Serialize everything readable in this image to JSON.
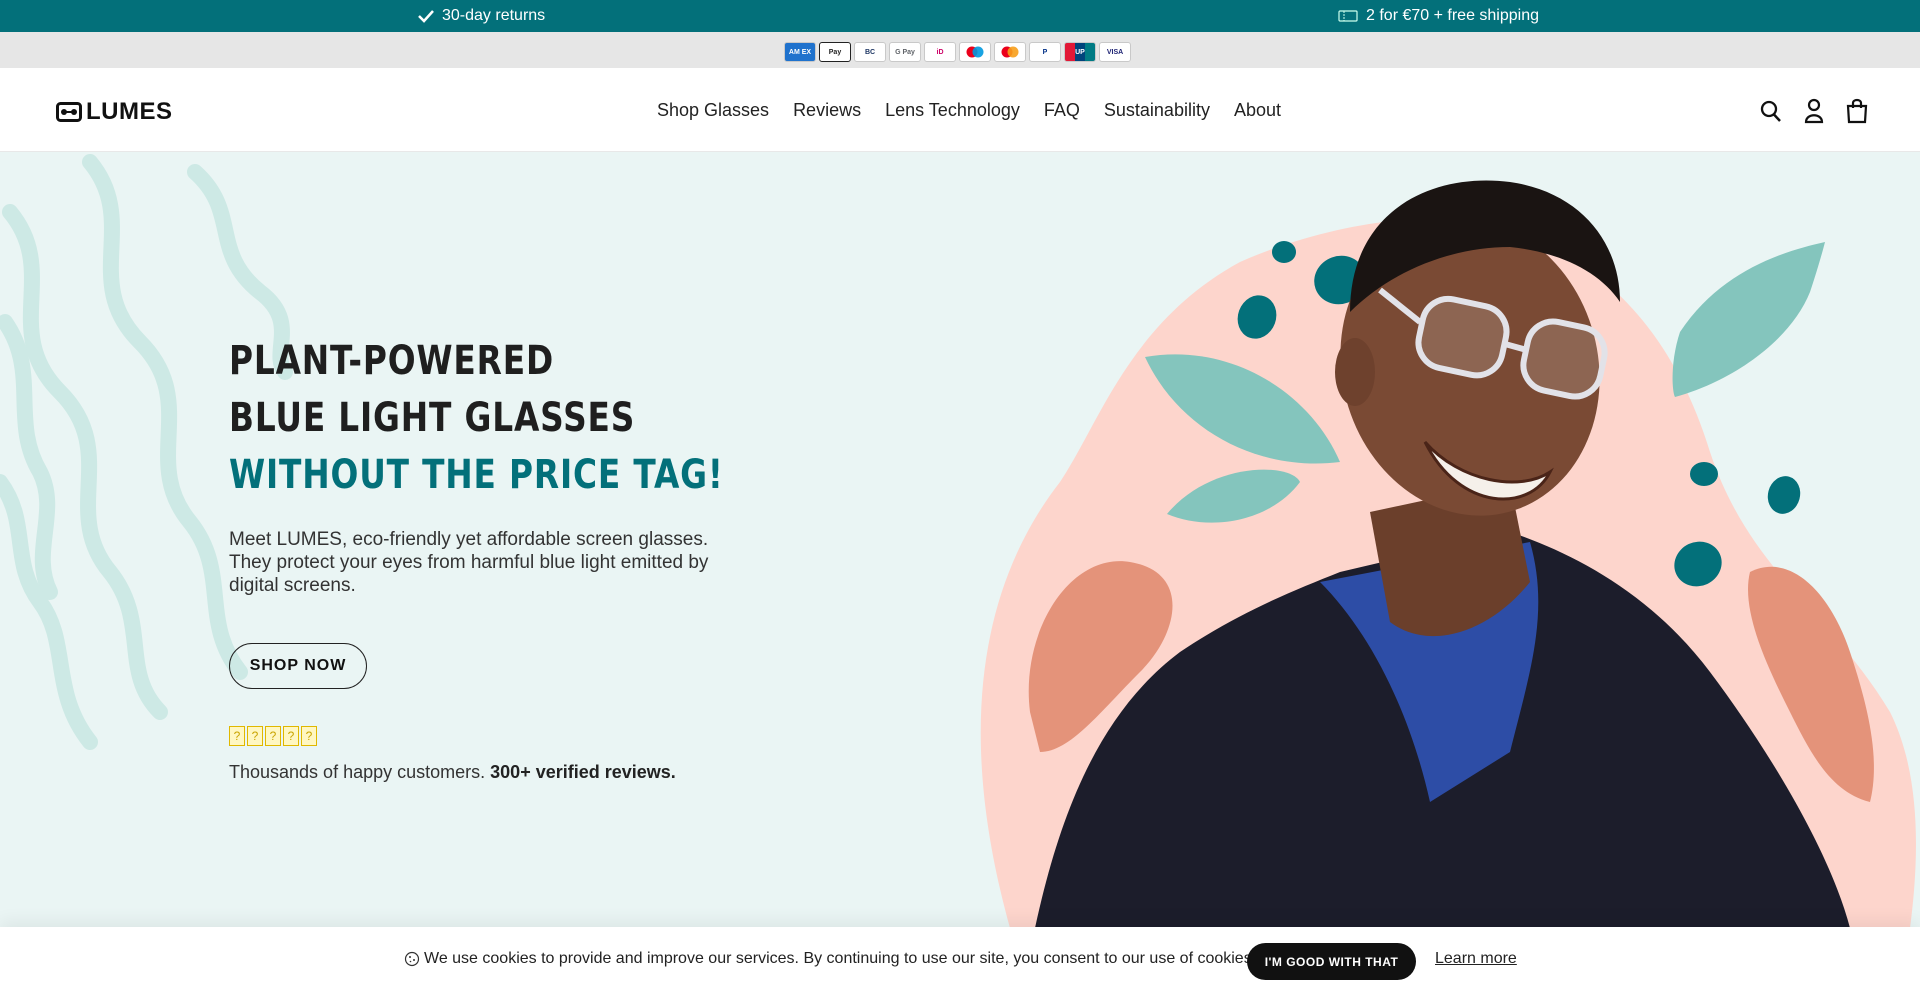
{
  "announcement": {
    "returns_text": "30-day returns",
    "returns_icon": "check-icon",
    "shipping_text": "2 for €70 + free shipping",
    "shipping_icon": "ticket-icon"
  },
  "payment_methods": [
    "American Express",
    "Apple Pay",
    "Bancontact",
    "Google Pay",
    "iDEAL",
    "Maestro",
    "Mastercard",
    "PayPal",
    "UnionPay",
    "Visa"
  ],
  "payment_labels": [
    "AM EX",
    "Pay",
    "BC",
    "G Pay",
    "iD",
    "Mae",
    "MC",
    "P",
    "UP",
    "VISA"
  ],
  "header": {
    "logo": "LUMES",
    "nav": [
      "Shop Glasses",
      "Reviews",
      "Lens Technology",
      "FAQ",
      "Sustainability",
      "About"
    ],
    "icons": [
      "search-icon",
      "account-icon",
      "cart-icon"
    ]
  },
  "hero": {
    "heading_line1": "Plant-powered",
    "heading_line2": "blue light glasses",
    "heading_line3": "without the price tag!",
    "description": "Meet LUMES, eco-friendly yet affordable screen glasses. They protect your eyes from harmful blue light emitted by digital screens.",
    "cta": "SHOP NOW",
    "rating": 5,
    "reviews_prefix": "Thousands of happy customers.",
    "reviews_bold": "300+ verified reviews."
  },
  "cookie": {
    "text": "We use cookies to provide and improve our services. By continuing to use our site, you consent to our use of cookies.",
    "accept": "I'M GOOD WITH THAT",
    "learn_more": "Learn more"
  },
  "colors": {
    "teal": "#03707a",
    "light_teal": "#84c5bd",
    "hero_bg": "#eaf5f4",
    "peach": "#fdd5cc",
    "terracotta": "#e4937a"
  }
}
